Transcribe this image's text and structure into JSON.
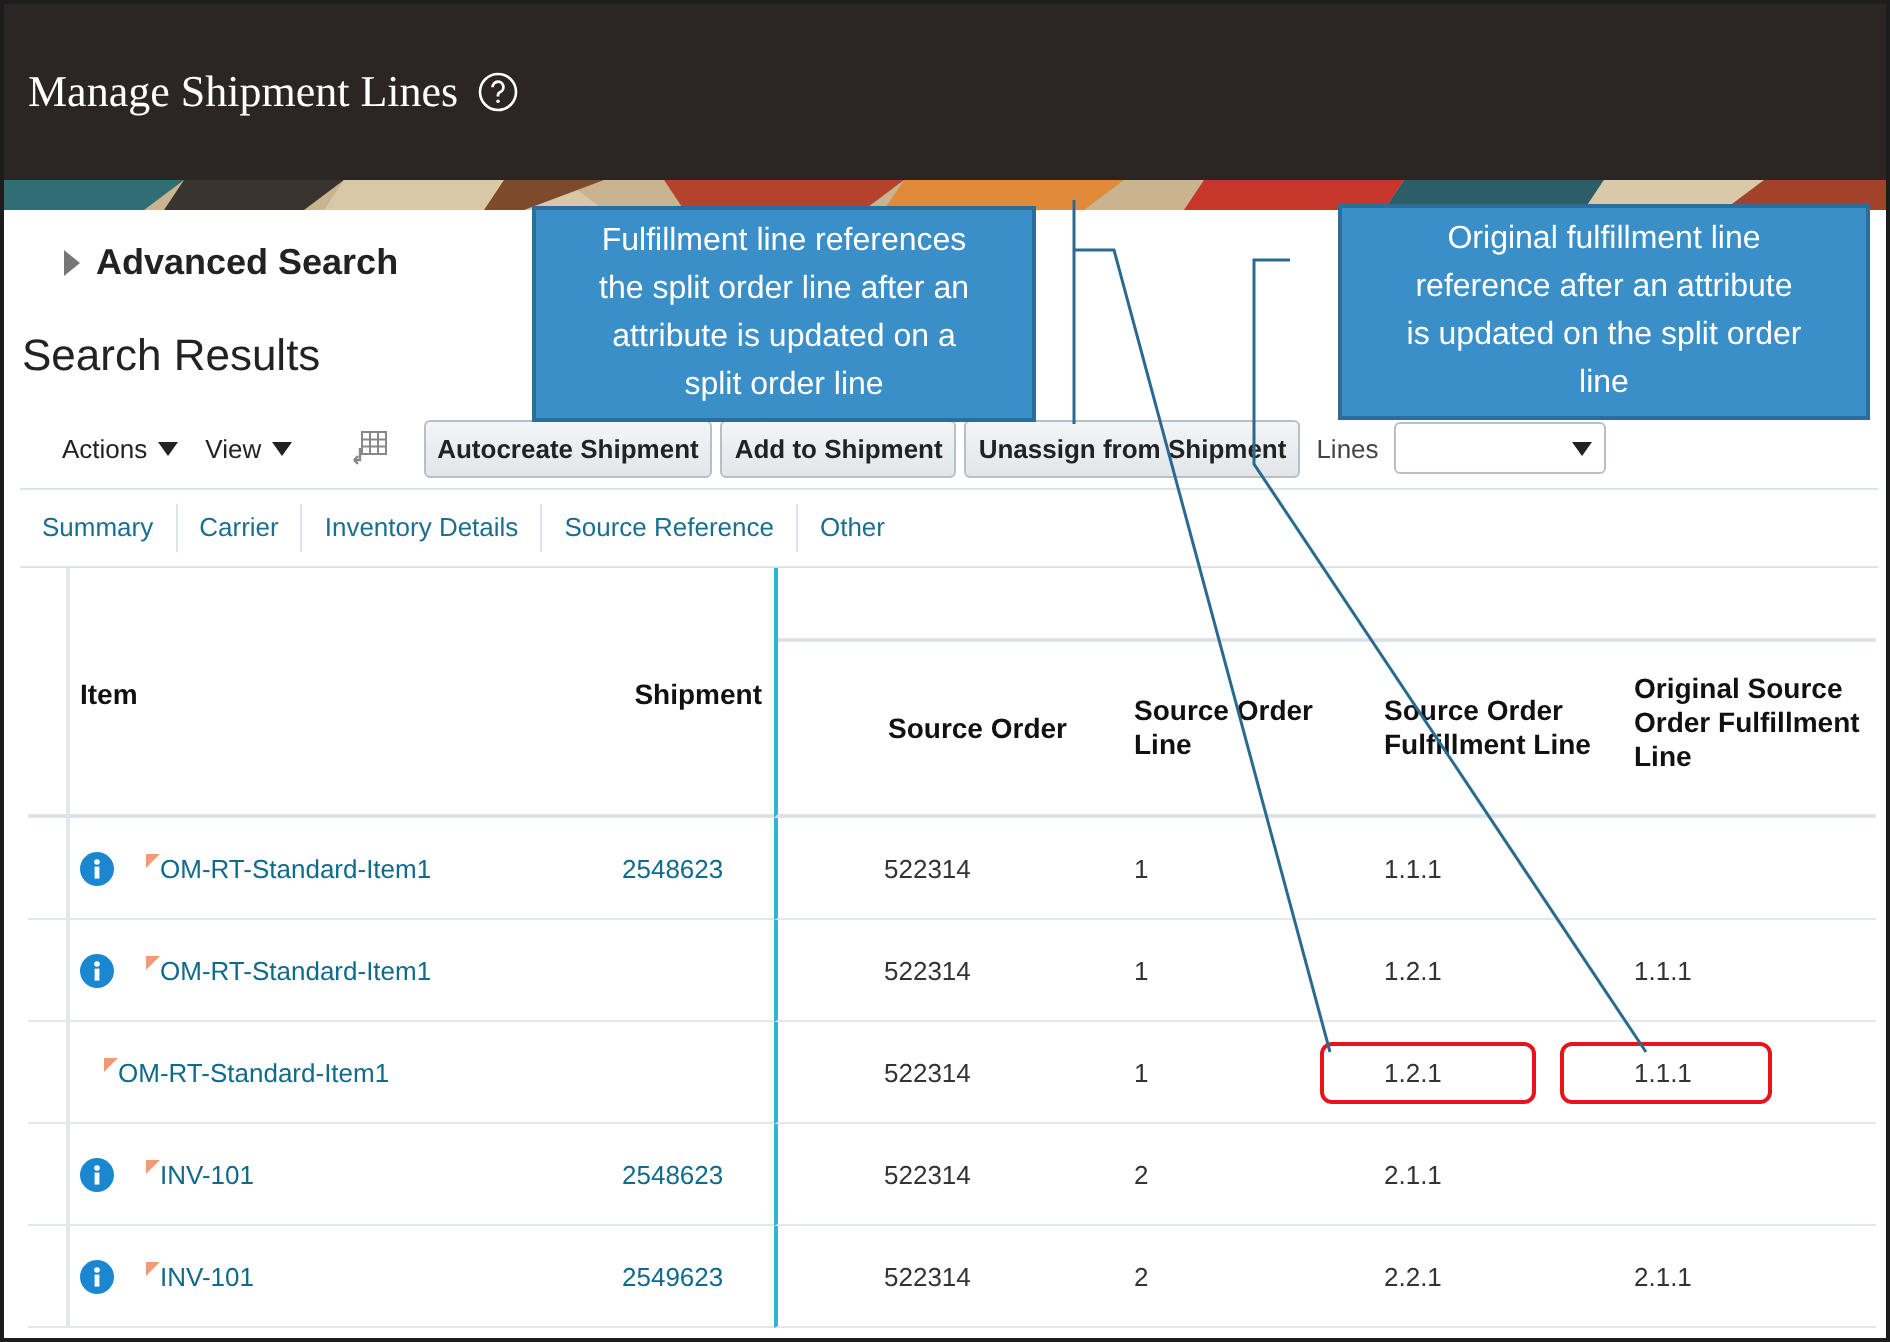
{
  "window": {
    "title": "Manage Shipment Lines"
  },
  "advanced_search": {
    "label": "Advanced Search",
    "expanded": false
  },
  "section_title": "Search Results",
  "toolbar": {
    "menus": [
      "Actions",
      "View"
    ],
    "buttons": [
      "Autocreate Shipment",
      "Add to Shipment",
      "Unassign from Shipment"
    ],
    "filter_label": "Lines"
  },
  "tabs": [
    {
      "label": "Summary",
      "selected": false
    },
    {
      "label": "Carrier",
      "selected": false
    },
    {
      "label": "Inventory Details",
      "selected": false
    },
    {
      "label": "Source Reference",
      "selected": false
    },
    {
      "label": "Other",
      "selected": false
    }
  ],
  "table": {
    "columns": [
      "Item",
      "Shipment",
      "Source Order",
      "Source Order Line",
      "Source Order Fulfillment Line",
      "Original Source Order Fulfillment Line"
    ],
    "rows": [
      {
        "info": true,
        "highlighted": false,
        "item": "OM-RT-Standard-Item1",
        "shipment": "2548623",
        "source_order": "522314",
        "source_order_line": "1",
        "fulfillment_line": "1.1.1"
      },
      {
        "info": true,
        "highlighted": false,
        "item": "OM-RT-Standard-Item1",
        "source_order": "522314",
        "source_order_line": "1",
        "fulfillment_line": "1.2.1",
        "original_fulfillment_line": "1.1.1"
      },
      {
        "info": false,
        "highlighted": true,
        "item": "OM-RT-Standard-Item1",
        "source_order": "522314",
        "source_order_line": "1",
        "fulfillment_line": "1.2.1",
        "original_fulfillment_line": "1.1.1"
      },
      {
        "info": true,
        "highlighted": false,
        "item": "INV-101",
        "shipment": "2548623",
        "source_order": "522314",
        "source_order_line": "2",
        "fulfillment_line": "2.1.1"
      },
      {
        "info": true,
        "highlighted": false,
        "item": "INV-101",
        "shipment": "2549623",
        "source_order": "522314",
        "source_order_line": "2",
        "fulfillment_line": "2.2.1",
        "original_fulfillment_line": "2.1.1"
      }
    ]
  },
  "callouts": [
    {
      "text": "Fulfillment line references the split order line after an attribute is updated on a split order line"
    },
    {
      "text": "Original fulfillment line reference after an attribute is updated on the split order line"
    }
  ]
}
